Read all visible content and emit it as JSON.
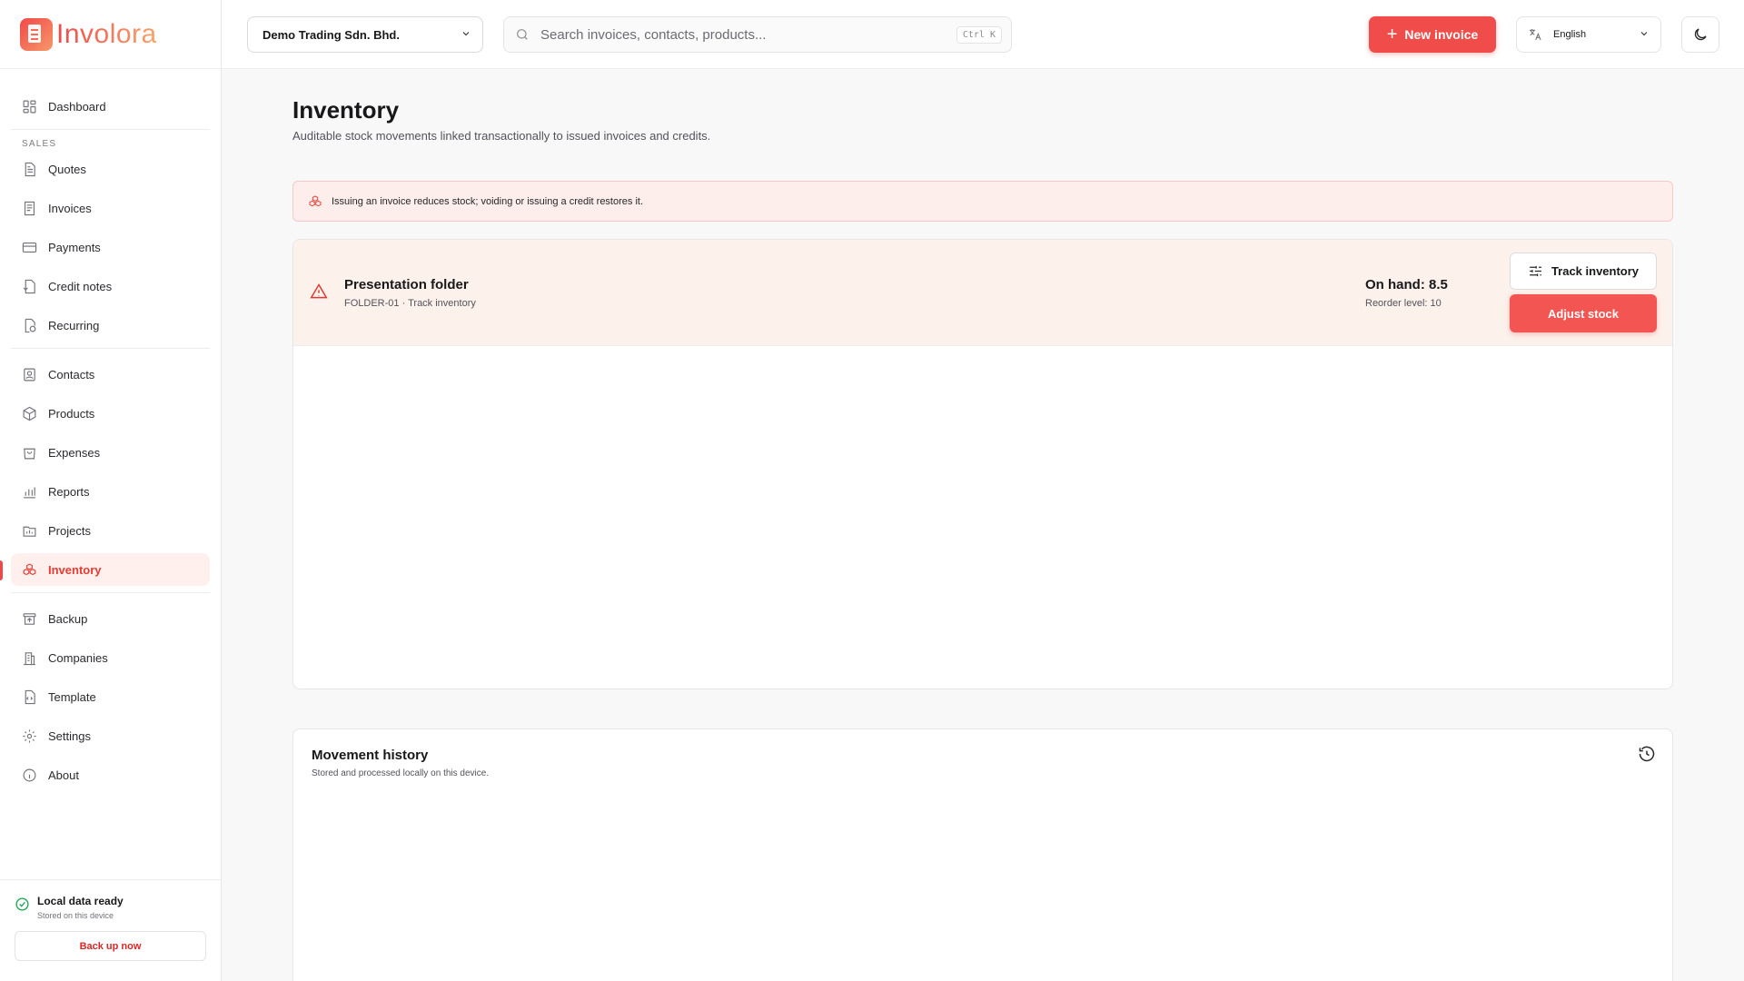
{
  "app": {
    "name": "Involora"
  },
  "sidebar": {
    "items_top": [
      {
        "label": "Dashboard",
        "icon": "dashboard-icon"
      }
    ],
    "sales_section": "SALES",
    "sales_items": [
      {
        "label": "Quotes",
        "icon": "quote-icon"
      },
      {
        "label": "Invoices",
        "icon": "invoice-icon"
      },
      {
        "label": "Payments",
        "icon": "card-icon"
      },
      {
        "label": "Credit notes",
        "icon": "credit-note-icon"
      },
      {
        "label": "Recurring",
        "icon": "recurring-icon"
      }
    ],
    "main_items": [
      {
        "label": "Contacts",
        "icon": "contacts-icon"
      },
      {
        "label": "Products",
        "icon": "box-icon"
      },
      {
        "label": "Expenses",
        "icon": "bag-icon"
      },
      {
        "label": "Reports",
        "icon": "chart-icon"
      },
      {
        "label": "Projects",
        "icon": "folder-icon"
      },
      {
        "label": "Inventory",
        "icon": "boxes-icon",
        "active": true
      }
    ],
    "system_items": [
      {
        "label": "Backup",
        "icon": "archive-icon"
      },
      {
        "label": "Companies",
        "icon": "building-icon"
      },
      {
        "label": "Template",
        "icon": "code-file-icon"
      },
      {
        "label": "Settings",
        "icon": "gear-icon"
      },
      {
        "label": "About",
        "icon": "info-icon"
      }
    ],
    "footer": {
      "status_title": "Local data ready",
      "status_sub": "Stored on this device",
      "backup_button": "Back up now"
    }
  },
  "topbar": {
    "company": "Demo Trading Sdn. Bhd.",
    "search_placeholder": "Search invoices, contacts, products...",
    "search_shortcut": "Ctrl K",
    "new_invoice": "New invoice",
    "language": "English"
  },
  "page": {
    "title": "Inventory",
    "subtitle": "Auditable stock movements linked transactionally to issued invoices and credits.",
    "alert": "Issuing an invoice reduces stock; voiding or issuing a credit restores it."
  },
  "product": {
    "name": "Presentation folder",
    "meta": "FOLDER-01 · Track inventory",
    "on_hand": "On hand: 8.5",
    "reorder": "Reorder level: 10",
    "track_button": "Track inventory",
    "adjust_button": "Adjust stock"
  },
  "history": {
    "title": "Movement history",
    "subtitle": "Stored and processed locally on this device."
  },
  "colors": {
    "accent": "#f04d4a",
    "active_bg": "#fff0ee",
    "alert_bg": "#fdeeec",
    "success": "#16a34a"
  }
}
